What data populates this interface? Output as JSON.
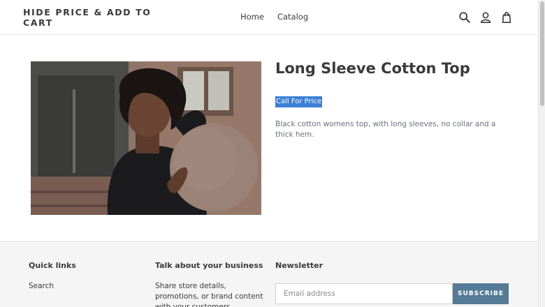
{
  "header": {
    "logo": "HIDE PRICE & ADD TO CART",
    "nav": [
      "Home",
      "Catalog"
    ],
    "icons": [
      "search-icon",
      "account-icon",
      "cart-icon"
    ]
  },
  "product": {
    "title": "Long Sleeve Cotton Top",
    "price_text": "Call For Price",
    "description": "Black cotton womens top, with long sleeves, no collar and a thick hem.",
    "image_alt": "Woman with curly hair in black top holding a pink ball"
  },
  "footer": {
    "quick_links": {
      "title": "Quick links",
      "items": [
        "Search"
      ]
    },
    "business": {
      "title": "Talk about your business",
      "text": "Share store details, promotions, or brand content with your customers."
    },
    "newsletter": {
      "title": "Newsletter",
      "placeholder": "Email address",
      "button": "SUBSCRIBE"
    }
  },
  "colors": {
    "accent_button": "#557b97",
    "selection": "#3b7fd6",
    "footer_bg": "#f5f5f5"
  }
}
